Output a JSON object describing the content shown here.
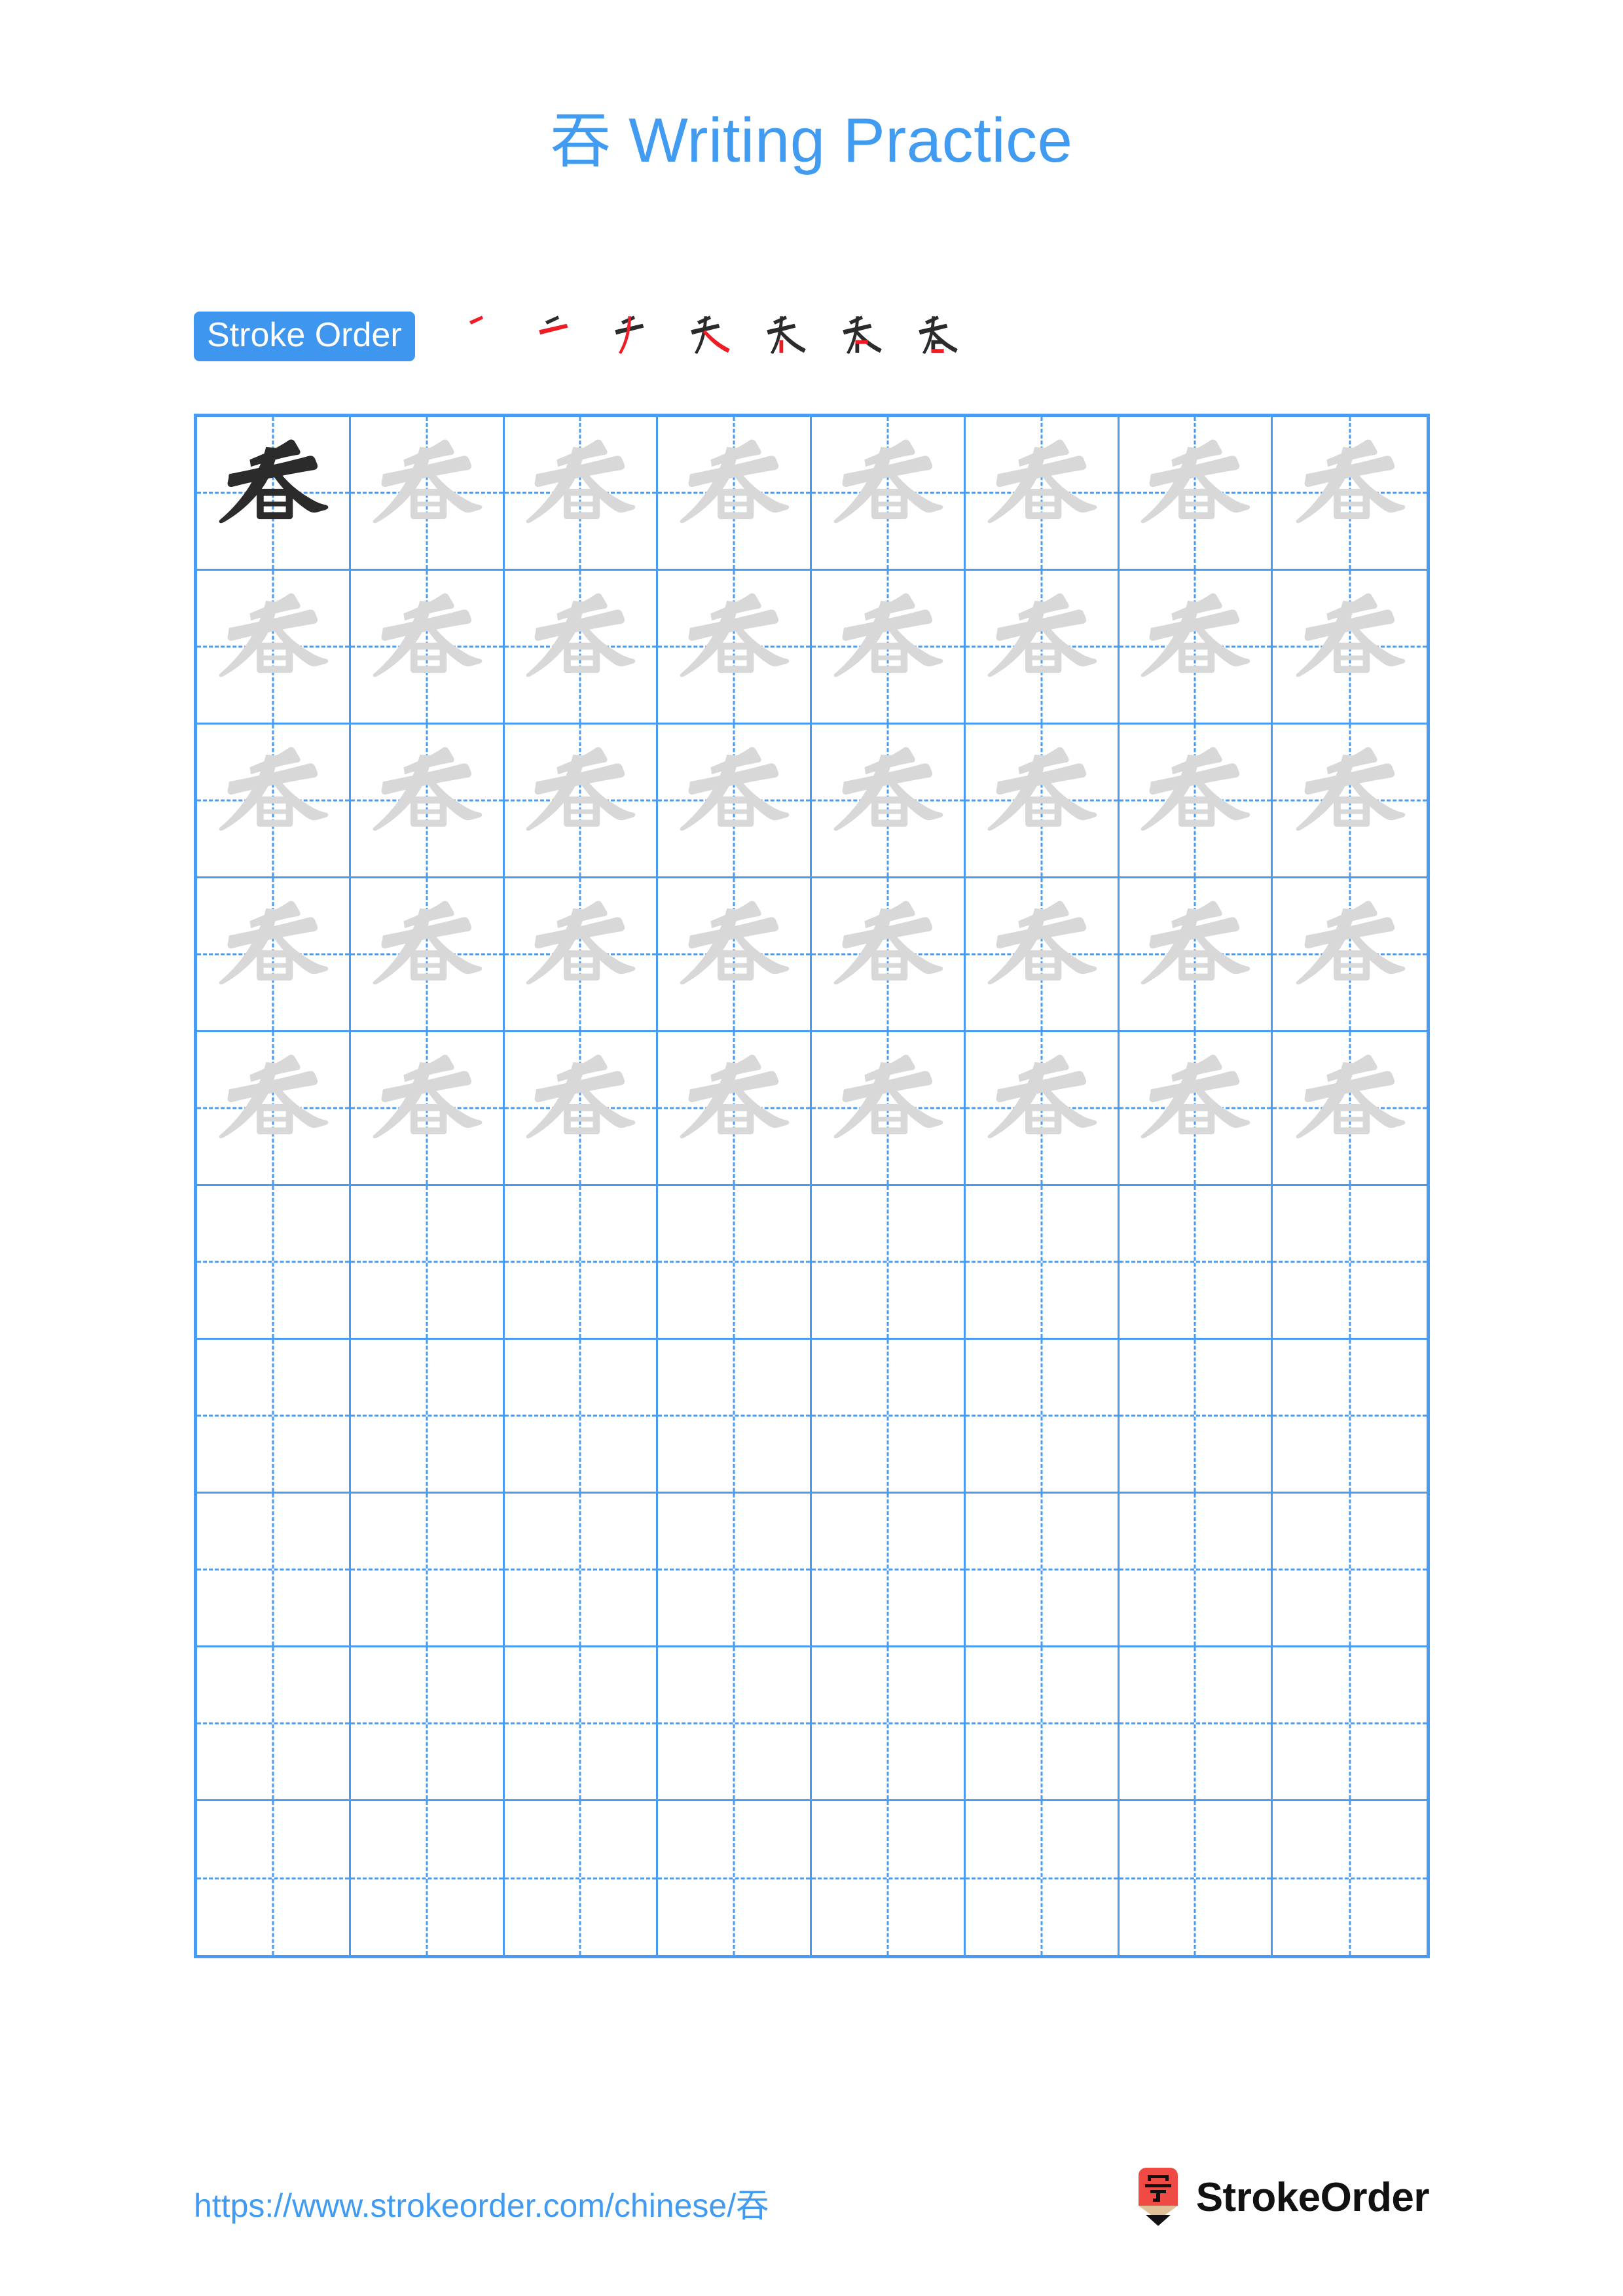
{
  "page": {
    "character": "吞",
    "title_text": "吞 Writing Practice",
    "title_suffix": " Writing Practice",
    "background_color": "#ffffff",
    "accent_color": "#419bf0",
    "grid_line_color": "#4a9cf2",
    "trace_char_color": "#d8d8d8",
    "model_char_color": "#2b2b2b",
    "stroke_highlight_color": "#ee1c25"
  },
  "stroke_order": {
    "badge_label": "Stroke Order",
    "badge_bg": "#3f96ef",
    "badge_text_color": "#ffffff",
    "stroke_count": 7,
    "steps": [
      {
        "index": 1,
        "strokes_shown": 1,
        "new_stroke": 1
      },
      {
        "index": 2,
        "strokes_shown": 2,
        "new_stroke": 2
      },
      {
        "index": 3,
        "strokes_shown": 3,
        "new_stroke": 3
      },
      {
        "index": 4,
        "strokes_shown": 4,
        "new_stroke": 4
      },
      {
        "index": 5,
        "strokes_shown": 5,
        "new_stroke": 5
      },
      {
        "index": 6,
        "strokes_shown": 6,
        "new_stroke": 6
      },
      {
        "index": 7,
        "strokes_shown": 7,
        "new_stroke": 7
      }
    ]
  },
  "practice_grid": {
    "columns": 8,
    "rows": 10,
    "total_cells": 80,
    "cells_with_model": 1,
    "cells_with_trace": 39,
    "empty_cells": 40,
    "rows_filled": 5,
    "rows_empty": 5
  },
  "footer": {
    "url_text": "https://www.strokeorder.com/chinese/吞",
    "brand_name": "StrokeOrder",
    "logo_body_color": "#f04a44",
    "logo_wood_color": "#e0c097",
    "logo_tip_color": "#111111",
    "logo_glyph": "字"
  }
}
